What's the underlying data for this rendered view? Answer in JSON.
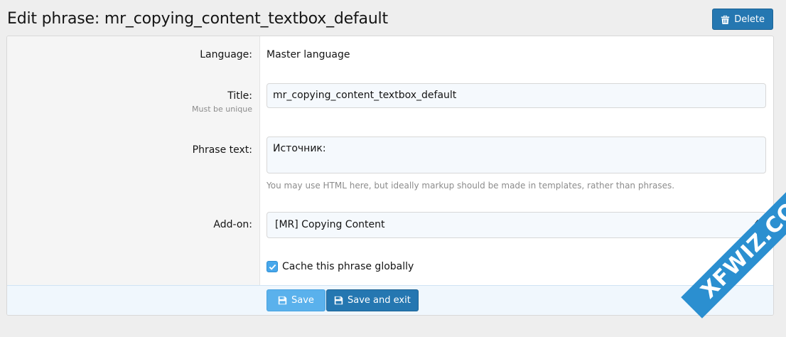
{
  "header": {
    "title": "Edit phrase: mr_copying_content_textbox_default",
    "delete_label": "Delete"
  },
  "form": {
    "language": {
      "label": "Language:",
      "value": "Master language"
    },
    "title": {
      "label": "Title:",
      "hint": "Must be unique",
      "value": "mr_copying_content_textbox_default"
    },
    "phrase_text": {
      "label": "Phrase text:",
      "value": "Источник:",
      "explain": "You may use HTML here, but ideally markup should be made in templates, rather than phrases."
    },
    "addon": {
      "label": "Add-on:",
      "selected": "[MR] Copying Content"
    },
    "cache_global": {
      "label": "Cache this phrase globally",
      "checked": true
    }
  },
  "actions": {
    "save_label": "Save",
    "save_exit_label": "Save and exit"
  },
  "watermark": {
    "text": "XFWIZ.COM"
  },
  "colors": {
    "primary": "#2577b1",
    "primary_light": "#5ab1ec",
    "checkbox": "#47a7eb"
  }
}
